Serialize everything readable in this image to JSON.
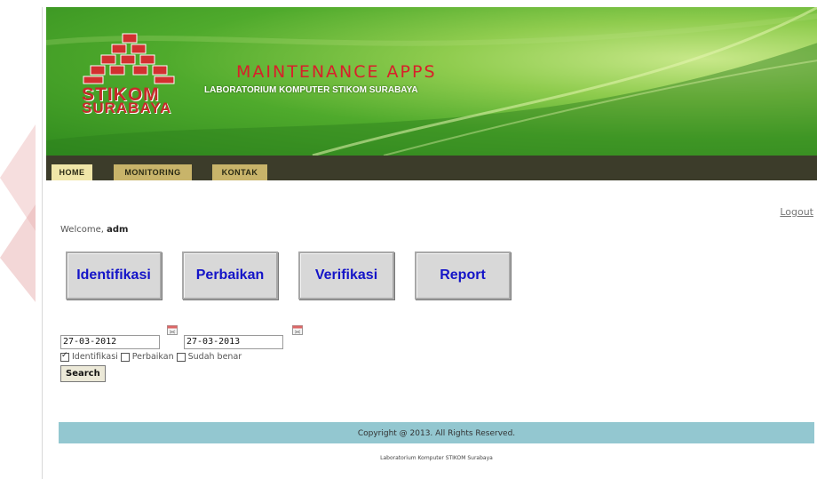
{
  "header": {
    "logo_line1": "STIKOM",
    "logo_line2": "SURABAYA",
    "title": "MAINTENANCE APPS",
    "subtitle": "LABORATORIUM KOMPUTER STIKOM SURABAYA"
  },
  "nav": {
    "tabs": [
      {
        "label": "HOME",
        "active": true
      },
      {
        "label": "MONITORING",
        "active": false
      },
      {
        "label": "KONTAK",
        "active": false
      }
    ]
  },
  "user": {
    "logout_label": "Logout",
    "welcome_prefix": "Welcome,",
    "username": "adm"
  },
  "menu": {
    "buttons": [
      {
        "label": "Identifikasi"
      },
      {
        "label": "Perbaikan"
      },
      {
        "label": "Verifikasi"
      },
      {
        "label": "Report"
      }
    ]
  },
  "filter": {
    "date_from": "27-03-2012",
    "date_to": "27-03-2013",
    "checkboxes": [
      {
        "label": "Identifikasi",
        "checked": true
      },
      {
        "label": "Perbaikan",
        "checked": false
      },
      {
        "label": "Sudah benar",
        "checked": false
      }
    ],
    "search_label": "Search"
  },
  "footer": {
    "copyright": "Copyright @ 2013. All Rights Reserved.",
    "subtext": "Laboratorium Komputer STIKOM Surabaya"
  },
  "colors": {
    "header_green": "#4faa2c",
    "nav_dark": "#3c3c2a",
    "tab_tan": "#c8b46a",
    "title_red": "#d8202a",
    "button_text_blue": "#1414c8",
    "footer_blue": "#93c7d0"
  }
}
